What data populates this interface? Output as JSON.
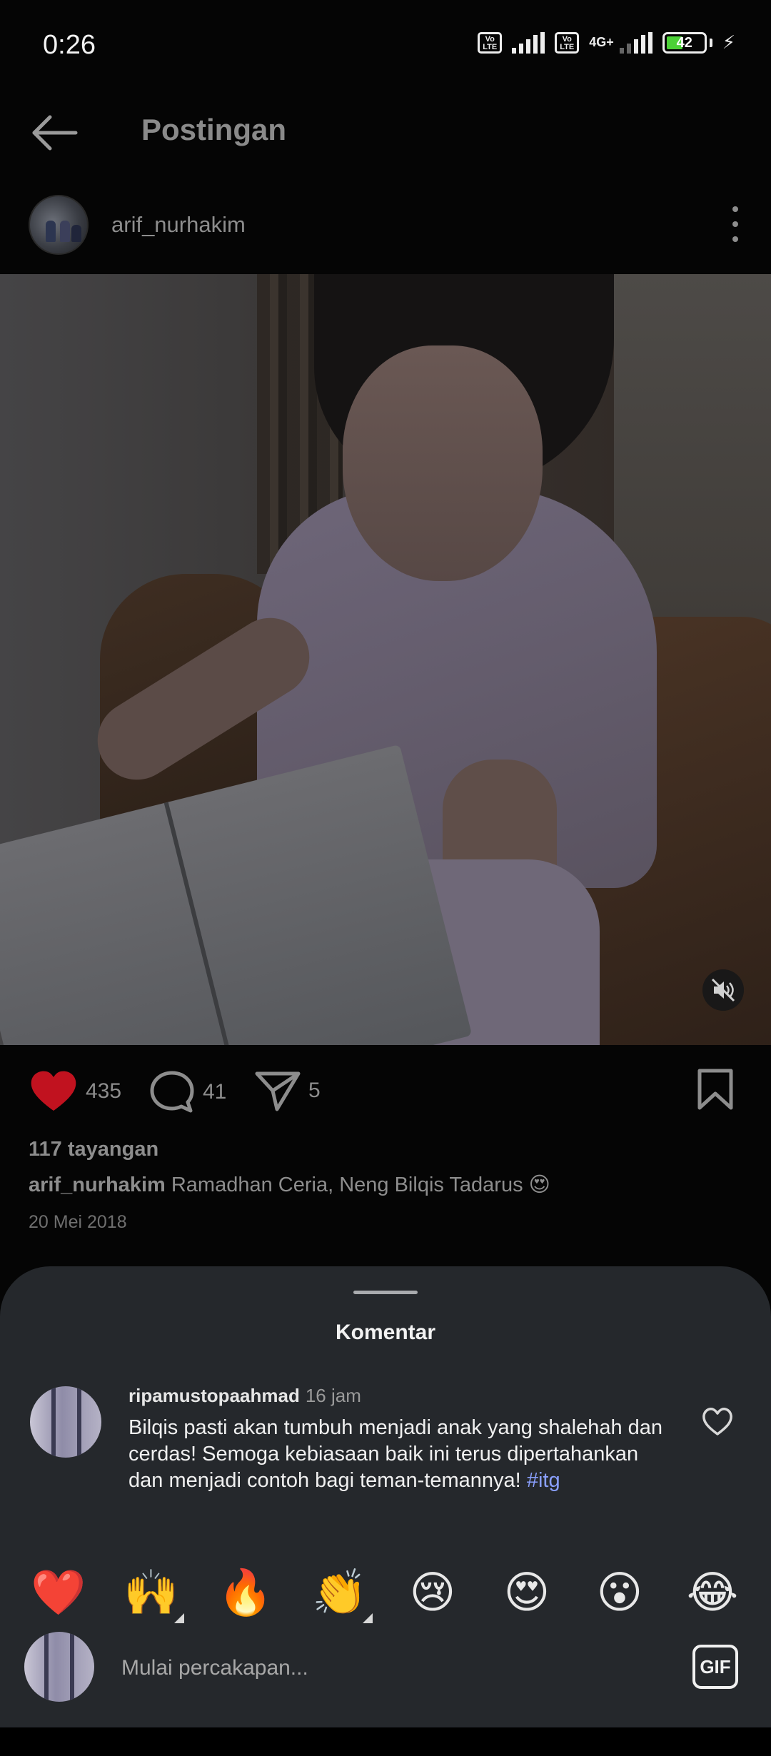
{
  "status_bar": {
    "time": "0:26",
    "volte": "Vo LTE",
    "network": "4G+",
    "battery": "42"
  },
  "header": {
    "title": "Postingan"
  },
  "post": {
    "author": "arif_nurhakim",
    "likes": "435",
    "comments": "41",
    "shares": "5",
    "views": "117 tayangan",
    "caption_user": "arif_nurhakim",
    "caption_text": "Ramadhan Ceria,  Neng Bilqis Tadarus 😍",
    "date": "20 Mei 2018"
  },
  "comments_sheet": {
    "title": "Komentar",
    "comment": {
      "user": "ripamustopaahmad",
      "time": "16 jam",
      "text": "Bilqis pasti akan tumbuh menjadi anak yang shalehah dan cerdas!  Semoga kebiasaan baik ini terus dipertahankan dan menjadi contoh bagi teman-temannya!",
      "hashtag": "#itg"
    },
    "emojis": [
      "❤️",
      "🙌",
      "🔥",
      "👏",
      "😢",
      "😍",
      "😮",
      "😂"
    ],
    "input_placeholder": "Mulai percakapan...",
    "gif_label": "GIF"
  },
  "colors": {
    "like_red": "#c1121f",
    "hashtag": "#8aa0ff",
    "sheet_bg": "#25282c"
  }
}
